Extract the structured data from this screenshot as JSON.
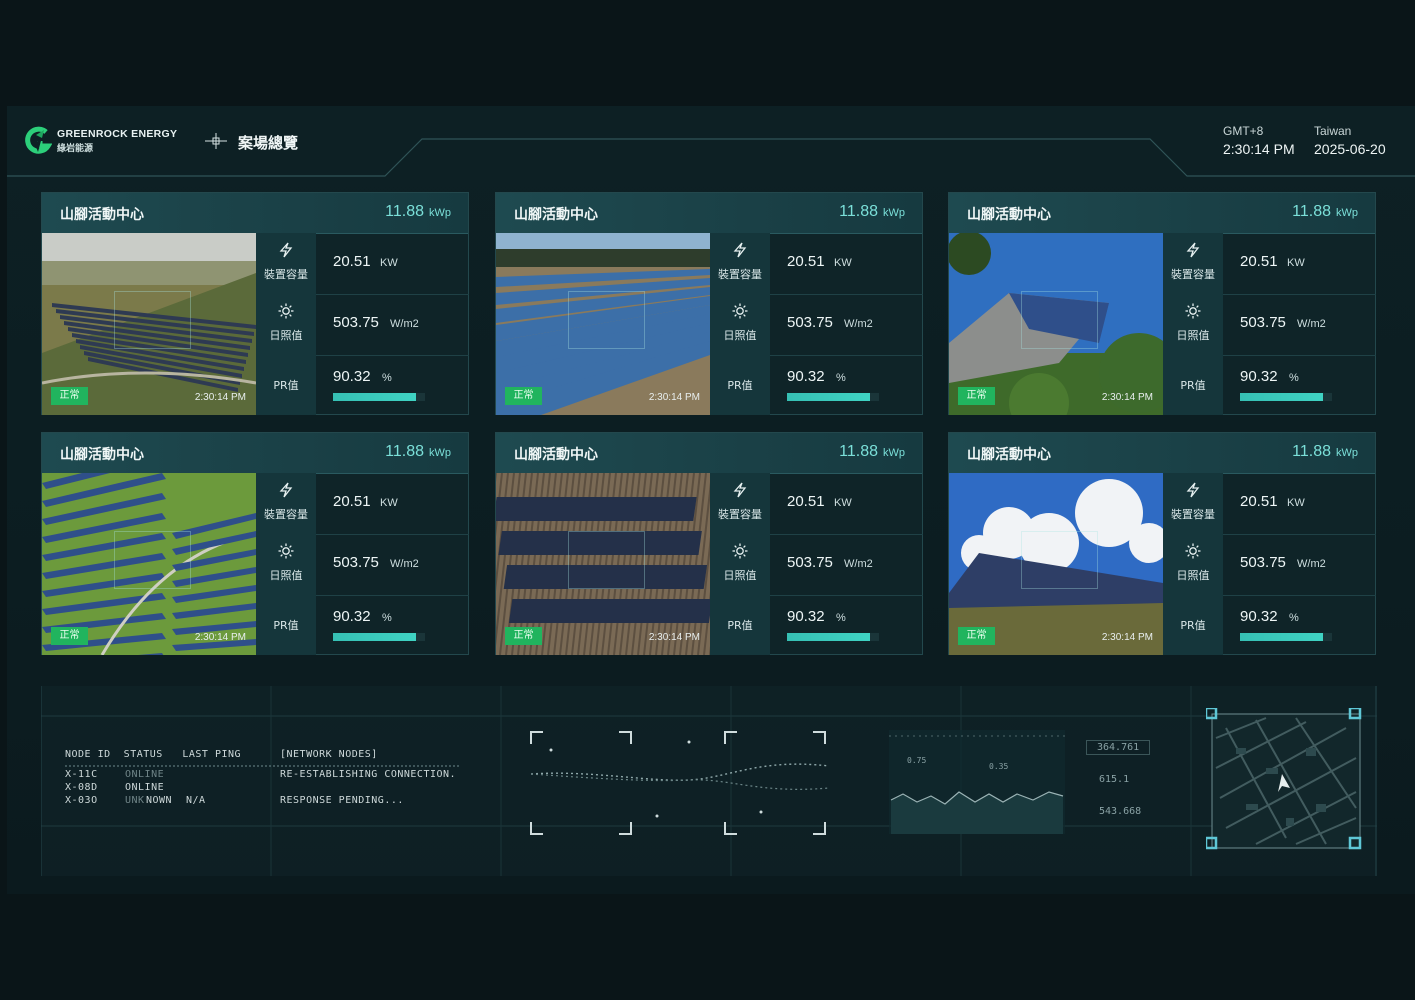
{
  "header": {
    "brand_name": "GREENROCK ENERGY",
    "brand_sub": "綠岩能源",
    "nav_title": "案場總覽",
    "timezone_label": "GMT+8",
    "time": "2:30:14 PM",
    "location_label": "Taiwan",
    "date": "2025-06-20"
  },
  "colors": {
    "accent": "#7be0d9",
    "status_ok": "#21b45e",
    "pr_bar": "#3fd3c3"
  },
  "cards": [
    {
      "title": "山腳活動中心",
      "capacity": "11.88",
      "capacity_unit": "kWp",
      "status": "正常",
      "timestamp": "2:30:14 PM",
      "device_label": "裝置容量",
      "device_value": "20.51",
      "device_unit": "KW",
      "irr_label": "日照值",
      "irr_value": "503.75",
      "irr_unit": "W/m2",
      "pr_label": "PR值",
      "pr_value": "90.32",
      "pr_unit": "%",
      "pr_fraction": 0.9032,
      "photo": "solar-farm-field"
    },
    {
      "title": "山腳活動中心",
      "capacity": "11.88",
      "capacity_unit": "kWp",
      "status": "正常",
      "timestamp": "2:30:14 PM",
      "device_label": "裝置容量",
      "device_value": "20.51",
      "device_unit": "KW",
      "irr_label": "日照值",
      "irr_value": "503.75",
      "irr_unit": "W/m2",
      "pr_label": "PR值",
      "pr_value": "90.32",
      "pr_unit": "%",
      "pr_fraction": 0.9032,
      "photo": "solar-panel-rows"
    },
    {
      "title": "山腳活動中心",
      "capacity": "11.88",
      "capacity_unit": "kWp",
      "status": "正常",
      "timestamp": "2:30:14 PM",
      "device_label": "裝置容量",
      "device_value": "20.51",
      "device_unit": "KW",
      "irr_label": "日照值",
      "irr_value": "503.75",
      "irr_unit": "W/m2",
      "pr_label": "PR值",
      "pr_value": "90.32",
      "pr_unit": "%",
      "pr_fraction": 0.9032,
      "photo": "barn-roof-solar"
    },
    {
      "title": "山腳活動中心",
      "capacity": "11.88",
      "capacity_unit": "kWp",
      "status": "正常",
      "timestamp": "2:30:14 PM",
      "device_label": "裝置容量",
      "device_value": "20.51",
      "device_unit": "KW",
      "irr_label": "日照值",
      "irr_value": "503.75",
      "irr_unit": "W/m2",
      "pr_label": "PR值",
      "pr_value": "90.32",
      "pr_unit": "%",
      "pr_fraction": 0.9032,
      "photo": "aerial-solar-hill"
    },
    {
      "title": "山腳活動中心",
      "capacity": "11.88",
      "capacity_unit": "kWp",
      "status": "正常",
      "timestamp": "2:30:14 PM",
      "device_label": "裝置容量",
      "device_value": "20.51",
      "device_unit": "KW",
      "irr_label": "日照值",
      "irr_value": "503.75",
      "irr_unit": "W/m2",
      "pr_label": "PR值",
      "pr_value": "90.32",
      "pr_unit": "%",
      "pr_fraction": 0.9032,
      "photo": "rooftop-solar-tin"
    },
    {
      "title": "山腳活動中心",
      "capacity": "11.88",
      "capacity_unit": "kWp",
      "status": "正常",
      "timestamp": "2:30:14 PM",
      "device_label": "裝置容量",
      "device_value": "20.51",
      "device_unit": "KW",
      "irr_label": "日照值",
      "irr_value": "503.75",
      "irr_unit": "W/m2",
      "pr_label": "PR值",
      "pr_value": "90.32",
      "pr_unit": "%",
      "pr_fraction": 0.9032,
      "photo": "ground-solar-sky"
    }
  ],
  "terminal": {
    "header": "NODE ID  STATUS   LAST PING",
    "network_header": "[NETWORK NODES]",
    "row1_id": "X-11C",
    "row1_status": "ONLINE",
    "row2_id": "X-08D",
    "row2_status": "ONLINE",
    "row3_id": "X-03O",
    "row3_status_dim": "UNK",
    "row3_status": "NOWN",
    "row3_ping": "N/A",
    "msg1": "RE-ESTABLISHING CONNECTION.",
    "msg2": "RESPONSE PENDING..."
  },
  "readouts": {
    "r1": "364.761",
    "r2": "615.1",
    "r3": "543.668",
    "chart_a": "0.75",
    "chart_b": "0.35"
  }
}
